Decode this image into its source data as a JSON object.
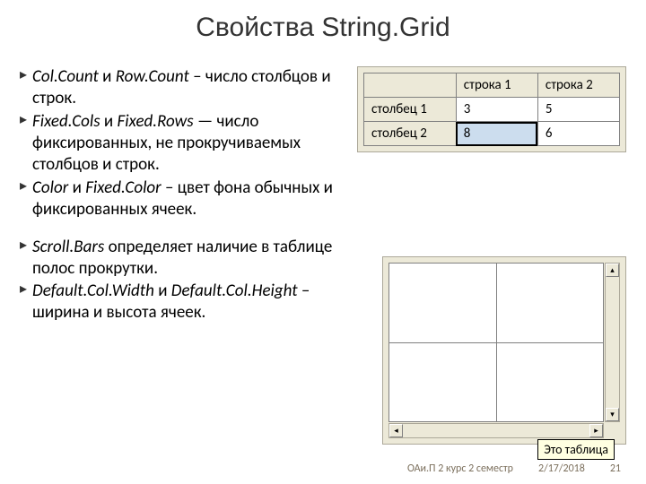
{
  "title": "Свойства String.Grid",
  "bullets": [
    {
      "em1": "Col.Count",
      "conj": " и ",
      "em2": "Row.Count",
      "rest": " – число столбцов и строк."
    },
    {
      "em1": "Fixed.Cols",
      "conj": " и ",
      "em2": "Fixed.Rows",
      "rest": " — число фиксированных, не прокручиваемых столбцов и строк."
    },
    {
      "em1": "Color",
      "conj": " и ",
      "em2": "Fixed.Color",
      "rest": " – цвет фона обычных и фиксированных ячеек."
    }
  ],
  "bullets2": [
    {
      "em1": "Scroll.Bars",
      "conj": "",
      "em2": "",
      "rest": " определяет наличие в таблице полос прокрутки."
    },
    {
      "em1": "Default.Col.Width",
      "conj": " и ",
      "em2": "Default.Col.Height",
      "rest": " – ширина и высота ячеек."
    }
  ],
  "grid": {
    "headers": [
      "",
      "строка 1",
      "строка 2"
    ],
    "rows": [
      {
        "rh": "столбец 1",
        "c1": "3",
        "c2": "5"
      },
      {
        "rh": "столбец 2",
        "c1": "8",
        "c2": "6"
      }
    ]
  },
  "scrollbox": {
    "tooltip": "Это таблица"
  },
  "footer": {
    "course": "ОАи.П 2 курс 2 семестр",
    "date": "2/17/2018",
    "page": "21"
  },
  "chart_data": {
    "type": "table",
    "title": "StringGrid example contents",
    "columns": [
      "",
      "строка 1",
      "строка 2"
    ],
    "rows": [
      [
        "столбец 1",
        3,
        5
      ],
      [
        "столбец 2",
        8,
        6
      ]
    ]
  }
}
